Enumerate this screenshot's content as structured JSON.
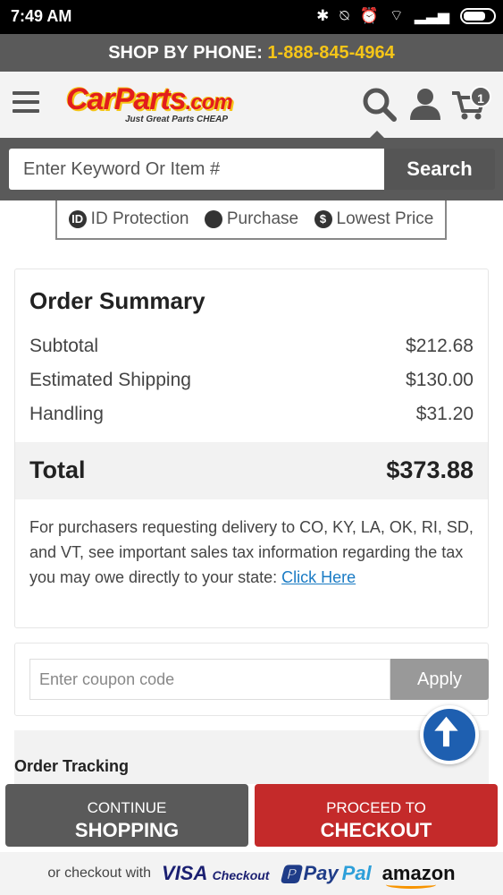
{
  "status_bar": {
    "time": "7:49 AM"
  },
  "phone_banner": {
    "label": "SHOP BY PHONE:",
    "number": "1-888-845-4964"
  },
  "header": {
    "logo_text": "CarParts",
    "logo_domain": ".com",
    "tagline": "Just Great Parts CHEAP",
    "cart_count": "1"
  },
  "search": {
    "placeholder": "Enter Keyword Or Item #",
    "button": "Search"
  },
  "trust_badges": [
    {
      "label": "ID Protection",
      "icon": "id-shield-icon"
    },
    {
      "label": "Purchase",
      "icon": "seal-icon"
    },
    {
      "label": "Lowest Price",
      "icon": "dollar-icon"
    }
  ],
  "order_summary": {
    "title": "Order Summary",
    "rows": [
      {
        "label": "Subtotal",
        "value": "$212.68"
      },
      {
        "label": "Estimated Shipping",
        "value": "$130.00"
      },
      {
        "label": "Handling",
        "value": "$31.20"
      }
    ],
    "total_label": "Total",
    "total_value": "$373.88",
    "tax_note": "For purchasers requesting delivery to CO, KY, LA, OK, RI, SD, and VT, see important sales tax information regarding the tax you may owe directly to your state: ",
    "tax_link": "Click Here"
  },
  "coupon": {
    "placeholder": "Enter coupon code",
    "button": "Apply"
  },
  "tracking": {
    "title": "Order Tracking"
  },
  "cta": {
    "shop_line1": "CONTINUE",
    "shop_line2": "SHOPPING",
    "checkout_line1": "PROCEED TO",
    "checkout_line2": "CHECKOUT"
  },
  "alt_checkout": {
    "prefix": "or checkout with",
    "visa": "VISA",
    "visa_suffix": "Checkout",
    "paypal_a": "Pay",
    "paypal_b": "Pal",
    "amazon": "amazon"
  },
  "colors": {
    "phone_number": "#f5c518",
    "checkout": "#c42a2a",
    "dark_gray": "#5a5a5a",
    "link": "#1a7bc4",
    "scroll_top": "#1e5fb0"
  }
}
